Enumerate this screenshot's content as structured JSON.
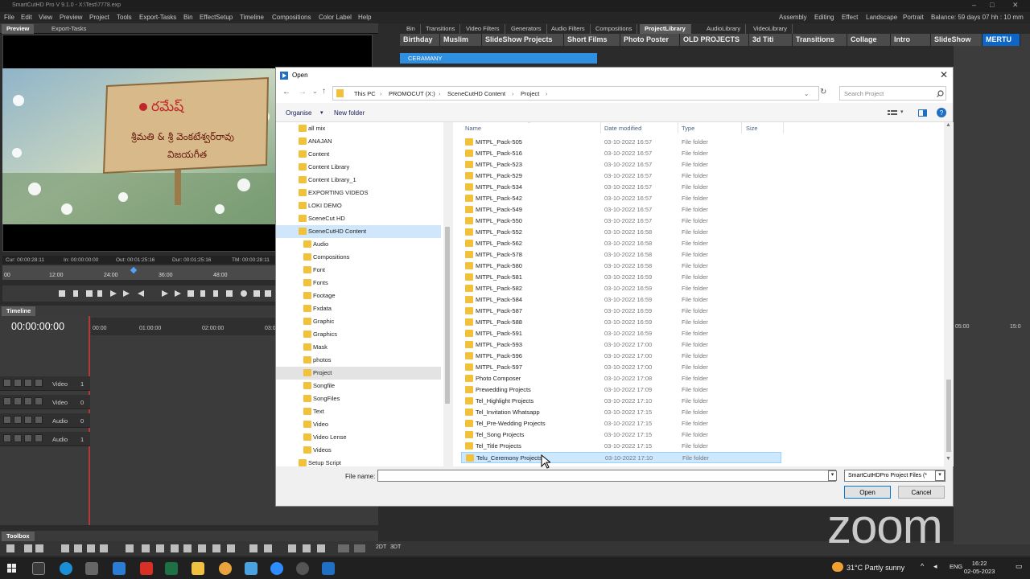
{
  "app": {
    "title": "SmartCutHD Pro V 9.1.0 - X:\\Test\\7778.exp",
    "menu": [
      "File",
      "Edit",
      "View",
      "Preview",
      "Project",
      "Tools",
      "Export-Tasks",
      "Bin",
      "EffectSetup",
      "Timeline",
      "Compositions",
      "Color Label",
      "Help"
    ],
    "workspaces": [
      "Assembly",
      "Editing",
      "Effect",
      "Landscape",
      "Portrait"
    ],
    "balance": "Balance: 59 days 07 hh : 10 mm"
  },
  "preview": {
    "tabs": [
      "Preview",
      "Export-Tasks"
    ],
    "timeinfo": [
      "Cur: 00:00:28:11",
      "In: 00:00:00:00",
      "Out: 00:01:25:16",
      "Dur: 00:01:25:16",
      "TM: 00:00:28:11"
    ],
    "ruler_ticks": [
      "00",
      "12:00",
      "24:00",
      "36:00",
      "48:00"
    ],
    "image_text": {
      "logo": "రమేష్",
      "line1": "శ్రీమతి & శ్రీ వెంకటేశ్వర్‌రావు",
      "line2": "విజయగీత"
    }
  },
  "timeline": {
    "tab": "Timeline",
    "timecode": "00:00:00:00",
    "ruler": [
      "00:00",
      "01:00:00",
      "02:00:00",
      "03:00:00"
    ],
    "ruler_right": [
      "05:00",
      "15:0"
    ],
    "tracks": [
      {
        "label": "Video",
        "num": "1"
      },
      {
        "label": "Video",
        "num": "0"
      },
      {
        "label": "Audio",
        "num": "0"
      },
      {
        "label": "Audio",
        "num": "1"
      }
    ]
  },
  "toolbox": {
    "tab": "Toolbox",
    "labels": [
      "2DT",
      "3DT"
    ]
  },
  "library": {
    "tabs1": [
      "Bin",
      "Transitions",
      "Video Filters",
      "Generators",
      "Audio Filters",
      "Compositions",
      "ProjectLibrary",
      "AudioLibrary",
      "VideoLibrary"
    ],
    "active_tab1": "ProjectLibrary",
    "tabs2": [
      "Birthday",
      "Muslim",
      "SlideShow Projects",
      "Short Films",
      "Photo Poster",
      "OLD PROJECTS",
      "3d Titi",
      "Transitions",
      "Collage",
      "Intro",
      "SlideShow",
      "MERTU"
    ],
    "active_tab2": "MERTU",
    "subtab": "CERAMANY"
  },
  "dialog": {
    "title": "Open",
    "path": [
      "This PC",
      "PROMOCUT (X:)",
      "SceneCutHD Content",
      "Project"
    ],
    "search_placeholder": "Search Project",
    "organise": "Organise",
    "new_folder": "New folder",
    "nav_items": [
      {
        "name": "all mix",
        "indent": 0
      },
      {
        "name": "ANAJAN",
        "indent": 0
      },
      {
        "name": "Content",
        "indent": 0
      },
      {
        "name": "Content Library",
        "indent": 0
      },
      {
        "name": "Content Library_1",
        "indent": 0
      },
      {
        "name": "EXPORTING VIDEOS",
        "indent": 0
      },
      {
        "name": "LOKI DEMO",
        "indent": 0
      },
      {
        "name": "SceneCut HD",
        "indent": 0
      },
      {
        "name": "SceneCutHD Content",
        "indent": 0,
        "state": "sel"
      },
      {
        "name": "Audio",
        "indent": 1
      },
      {
        "name": "Compositions",
        "indent": 1
      },
      {
        "name": "Font",
        "indent": 1
      },
      {
        "name": "Fonts",
        "indent": 1
      },
      {
        "name": "Footage",
        "indent": 1
      },
      {
        "name": "Fxdata",
        "indent": 1
      },
      {
        "name": "Graphic",
        "indent": 1
      },
      {
        "name": "Graphics",
        "indent": 1
      },
      {
        "name": "Mask",
        "indent": 1
      },
      {
        "name": "photos",
        "indent": 1
      },
      {
        "name": "Project",
        "indent": 1,
        "state": "cur"
      },
      {
        "name": "Songfile",
        "indent": 1
      },
      {
        "name": "SongFiles",
        "indent": 1
      },
      {
        "name": "Text",
        "indent": 1
      },
      {
        "name": "Video",
        "indent": 1
      },
      {
        "name": "Video Lense",
        "indent": 1
      },
      {
        "name": "Videos",
        "indent": 1
      },
      {
        "name": "Setup Script",
        "indent": 0
      }
    ],
    "columns": [
      "Name",
      "Date modified",
      "Type",
      "Size"
    ],
    "files": [
      {
        "name": "MITPL_Pack-505",
        "date": "03-10-2022 16:57",
        "type": "File folder"
      },
      {
        "name": "MITPL_Pack-516",
        "date": "03-10-2022 16:57",
        "type": "File folder"
      },
      {
        "name": "MITPL_Pack-523",
        "date": "03-10-2022 16:57",
        "type": "File folder"
      },
      {
        "name": "MITPL_Pack-529",
        "date": "03-10-2022 16:57",
        "type": "File folder"
      },
      {
        "name": "MITPL_Pack-534",
        "date": "03-10-2022 16:57",
        "type": "File folder"
      },
      {
        "name": "MITPL_Pack-542",
        "date": "03-10-2022 16:57",
        "type": "File folder"
      },
      {
        "name": "MITPL_Pack-549",
        "date": "03-10-2022 16:57",
        "type": "File folder"
      },
      {
        "name": "MITPL_Pack-550",
        "date": "03-10-2022 16:57",
        "type": "File folder"
      },
      {
        "name": "MITPL_Pack-552",
        "date": "03-10-2022 16:58",
        "type": "File folder"
      },
      {
        "name": "MITPL_Pack-562",
        "date": "03-10-2022 16:58",
        "type": "File folder"
      },
      {
        "name": "MITPL_Pack-578",
        "date": "03-10-2022 16:58",
        "type": "File folder"
      },
      {
        "name": "MITPL_Pack-580",
        "date": "03-10-2022 16:58",
        "type": "File folder"
      },
      {
        "name": "MITPL_Pack-581",
        "date": "03-10-2022 16:59",
        "type": "File folder"
      },
      {
        "name": "MITPL_Pack-582",
        "date": "03-10-2022 16:59",
        "type": "File folder"
      },
      {
        "name": "MITPL_Pack-584",
        "date": "03-10-2022 16:59",
        "type": "File folder"
      },
      {
        "name": "MITPL_Pack-587",
        "date": "03-10-2022 16:59",
        "type": "File folder"
      },
      {
        "name": "MITPL_Pack-588",
        "date": "03-10-2022 16:59",
        "type": "File folder"
      },
      {
        "name": "MITPL_Pack-591",
        "date": "03-10-2022 16:59",
        "type": "File folder"
      },
      {
        "name": "MITPL_Pack-593",
        "date": "03-10-2022 17:00",
        "type": "File folder"
      },
      {
        "name": "MITPL_Pack-596",
        "date": "03-10-2022 17:00",
        "type": "File folder"
      },
      {
        "name": "MITPL_Pack-597",
        "date": "03-10-2022 17:00",
        "type": "File folder"
      },
      {
        "name": "Photo Composer",
        "date": "03-10-2022 17:08",
        "type": "File folder"
      },
      {
        "name": "Prewedding Projects",
        "date": "03-10-2022 17:09",
        "type": "File folder"
      },
      {
        "name": "Tel_Highlight Projects",
        "date": "03-10-2022 17:10",
        "type": "File folder"
      },
      {
        "name": "Tel_Invitation Whatsapp",
        "date": "03-10-2022 17:15",
        "type": "File folder"
      },
      {
        "name": "Tel_Pre-Wedding Projects",
        "date": "03-10-2022 17:15",
        "type": "File folder"
      },
      {
        "name": "Tel_Song Projects",
        "date": "03-10-2022 17:15",
        "type": "File folder"
      },
      {
        "name": "Tel_Title Projects",
        "date": "03-10-2022 17:15",
        "type": "File folder"
      },
      {
        "name": "Telu_Ceremony Projects",
        "date": "03-10-2022 17:10",
        "type": "File folder",
        "selected": true
      }
    ],
    "filename_label": "File name:",
    "filename_value": "",
    "filetype": "SmartCutHDPro Project Files (*",
    "open_btn": "Open",
    "cancel_btn": "Cancel"
  },
  "overlay": {
    "zoom": "zoom"
  },
  "taskbar": {
    "weather": "31°C  Partly sunny",
    "lang": "ENG",
    "time": "16:22",
    "date": "02-05-2023"
  },
  "colors": {
    "accent": "#0e66c6",
    "selection": "#cce8ff",
    "folder": "#f2c13a"
  }
}
